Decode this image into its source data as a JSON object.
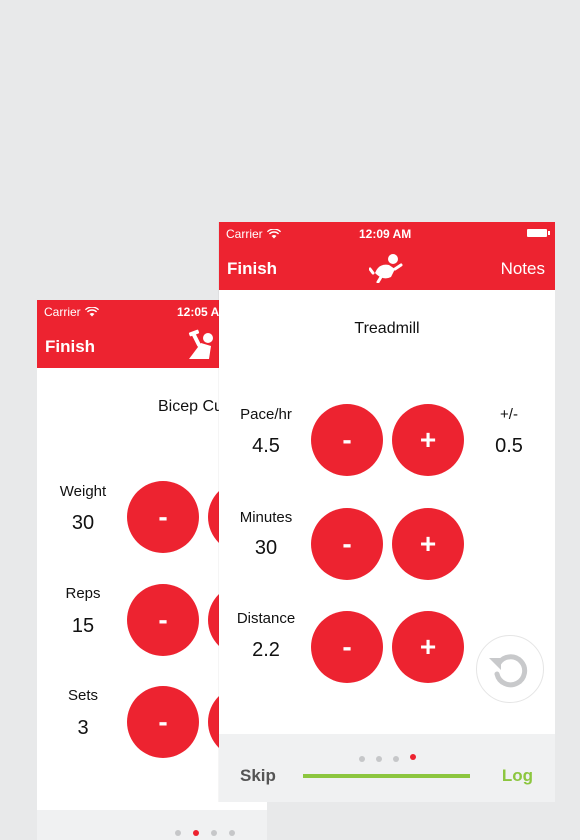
{
  "colors": {
    "primary": "#ed2330",
    "accent_green": "#8cc63f",
    "background": "#e8e9ea",
    "bar_gray": "#f0f1f2"
  },
  "back_phone": {
    "status": {
      "carrier": "Carrier",
      "time": "12:05 AM"
    },
    "nav": {
      "finish_label": "Finish",
      "logo_icon": "dumbbell-curl-icon"
    },
    "exercise_title": "Bicep Curls",
    "fields": [
      {
        "label": "Weight",
        "value": "30",
        "minus": "-",
        "plus": "+"
      },
      {
        "label": "Reps",
        "value": "15",
        "minus": "-",
        "plus": "+"
      },
      {
        "label": "Sets",
        "value": "3",
        "minus": "-",
        "plus": "+"
      }
    ]
  },
  "front_phone": {
    "status": {
      "carrier": "Carrier",
      "time": "12:09 AM"
    },
    "nav": {
      "finish_label": "Finish",
      "notes_label": "Notes",
      "logo_icon": "running-person-icon"
    },
    "exercise_title": "Treadmill",
    "fields": [
      {
        "label": "Pace/hr",
        "value": "4.5",
        "minus": "-",
        "plus": "+"
      },
      {
        "label": "Minutes",
        "value": "30",
        "minus": "-",
        "plus": "+"
      },
      {
        "label": "Distance",
        "value": "2.2",
        "minus": "-",
        "plus": "+"
      }
    ],
    "increment": {
      "label": "+/-",
      "value": "0.5"
    },
    "bottom": {
      "skip_label": "Skip",
      "log_label": "Log",
      "page_count": 4,
      "active_page": 4
    }
  },
  "reset_icon": "undo-arrow-icon"
}
